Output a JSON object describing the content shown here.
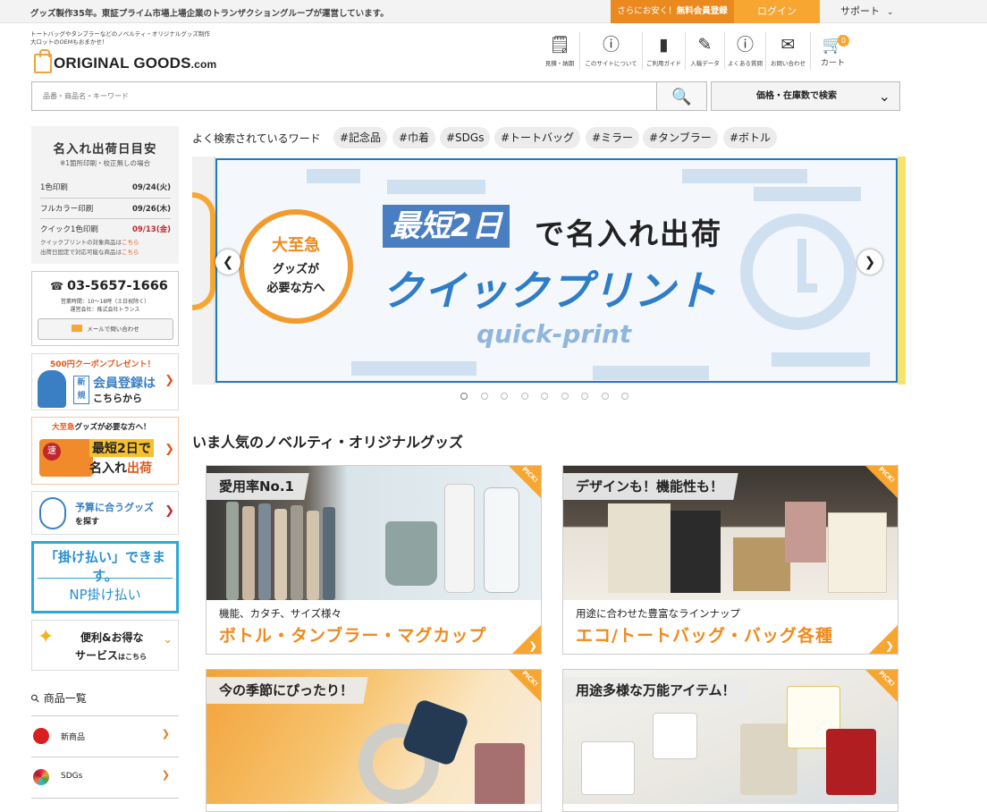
{
  "topbar": {
    "notice": "グッズ製作35年。東証プライム市場上場企業のトランザクショングループが運営しています。",
    "promo_prefix": "さらにお安く！",
    "promo_main": "無料会員登録",
    "login": "ログイン",
    "support": "サポート"
  },
  "header": {
    "tagline_1": "トートバッグやタンブラーなどのノベルティ・オリジナルグッズ制作",
    "tagline_2": "大ロットのOEMもおまかせ！",
    "logo_main": "ORIGINAL GOODS",
    "logo_suffix": ".com",
    "nav": [
      {
        "label": "見積・納期",
        "icon": "estimate-icon"
      },
      {
        "label": "このサイトについて",
        "icon": "info-icon"
      },
      {
        "label": "ご利用ガイド",
        "icon": "guide-icon"
      },
      {
        "label": "入稿データ",
        "icon": "data-icon"
      },
      {
        "label": "よくある質問",
        "icon": "faq-icon"
      },
      {
        "label": "お問い合わせ",
        "icon": "mail-icon"
      }
    ],
    "cart_label": "カート",
    "cart_count": "0"
  },
  "search": {
    "placeholder": "品番・商品名・キーワード",
    "price_stock_button": "価格・在庫数で検索"
  },
  "shipping": {
    "title": "名入れ出荷日目安",
    "note": "※1箇所印刷・校正無しの場合",
    "rows": [
      {
        "label": "1色印刷",
        "date": "09/24(火)"
      },
      {
        "label": "フルカラー印刷",
        "date": "09/26(木)"
      },
      {
        "label": "クイック1色印刷",
        "date": "09/13(金)"
      }
    ],
    "note2_prefix": "クイックプリントの対象商品は",
    "note3_prefix": "出荷日固定で対応可能な商品は",
    "here": "こちら"
  },
  "contact": {
    "phone": "03-5657-1666",
    "hours": "営業時間：10〜18時（土日祝除く）",
    "company": "運営会社：株式会社トランス",
    "mail": "メールで問い合わせ"
  },
  "side_banners": {
    "coupon": "500円クーポンプレゼント！",
    "new_badge": "新規",
    "register_1": "会員登録は",
    "register_2": "こちらから",
    "urgent_top_1": "大至急",
    "urgent_top_2": "グッズが必要な方へ！",
    "urgent_m1": "最短2日で",
    "urgent_m2a": "名入れ",
    "urgent_m2b": "出荷",
    "budget_1": "予算に合うグッズ",
    "budget_2": "を探す",
    "np_1": "「掛け払い」できます。",
    "np_2": "NP掛け払い",
    "benefit_1": "便利&お得な",
    "benefit_2a": "サービス",
    "benefit_2b": "はこちら"
  },
  "categories": {
    "heading": "商品一覧",
    "items": [
      {
        "label": "新商品"
      },
      {
        "label": "SDGs"
      }
    ]
  },
  "keywords": {
    "label": "よく検索されているワード",
    "items": [
      "#記念品",
      "#巾着",
      "#SDGs",
      "#トートバッグ",
      "#ミラー",
      "#タンブラー",
      "#ボトル"
    ]
  },
  "slider": {
    "bubble_1": "大至急",
    "bubble_2": "グッズが",
    "bubble_3": "必要な方へ",
    "headline_highlight": "最短2日",
    "headline_rest": "で名入れ出荷",
    "product": "クイックプリント",
    "product_en": "quick-print",
    "dot_count": 9,
    "active_dot": 0
  },
  "popular": {
    "title": "いま人気のノベルティ・オリジナルグッズ",
    "pick": "PICK!",
    "cards": [
      {
        "tag": "愛用率No.1",
        "sub": "機能、カタチ、サイズ様々",
        "title": "ボトル・タンブラー・マグカップ"
      },
      {
        "tag": "デザインも！機能性も！",
        "sub": "用途に合わせた豊富なラインナップ",
        "title": "エコ/トートバッグ・バッグ各種"
      },
      {
        "tag": "今の季節にぴったり！",
        "sub": "",
        "title": ""
      },
      {
        "tag": "用途多様な万能アイテム！",
        "sub": "",
        "title": ""
      }
    ]
  },
  "colors": {
    "accent": "#f7a632",
    "promo": "#ea8a1e",
    "blue": "#2d7dc8"
  }
}
